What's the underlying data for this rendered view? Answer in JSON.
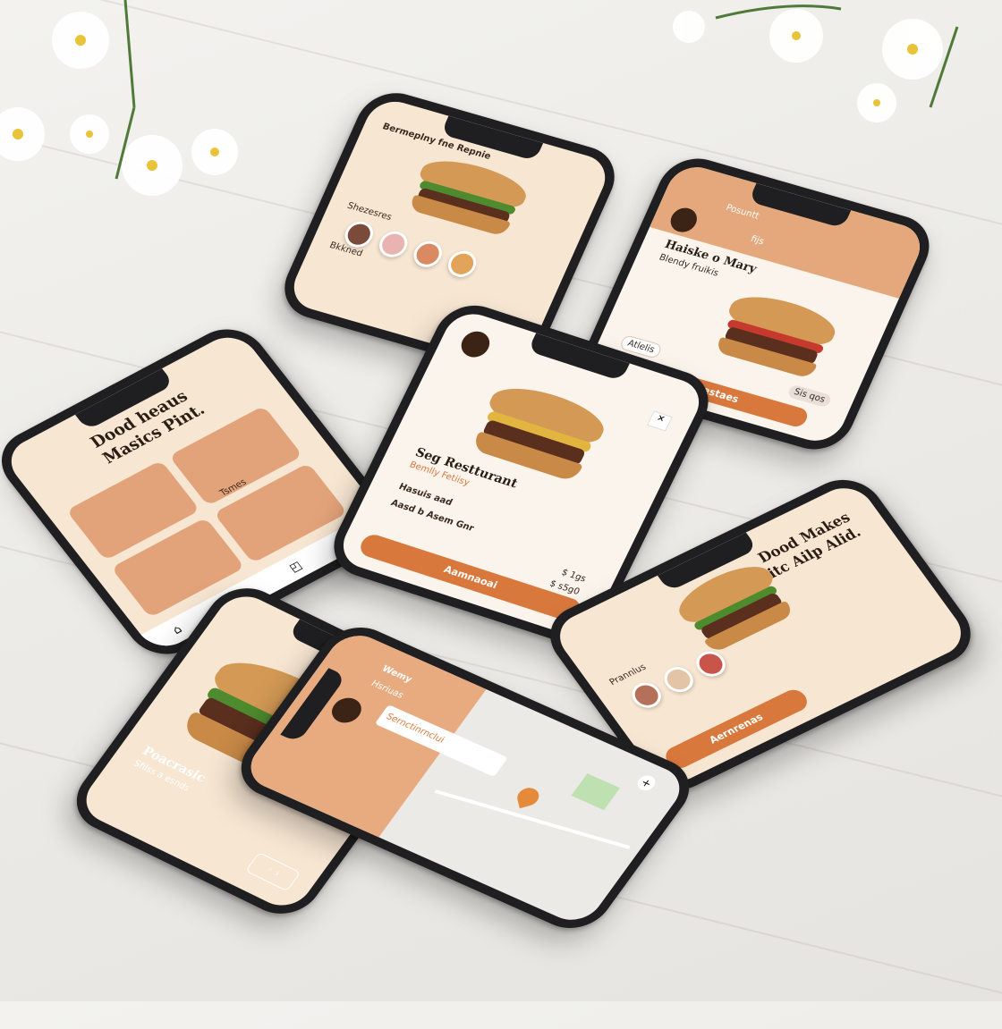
{
  "colors": {
    "accent": "#d9783d",
    "cream": "#f7e6d2",
    "peach": "#e9b48a",
    "dark": "#1f1f21"
  },
  "phones": {
    "top_center": {
      "header": "Bermeplny fne Repnie",
      "section1": "Shezesres",
      "section2": "Bkkned"
    },
    "top_right": {
      "header": "Posuntt",
      "tag": "fijs",
      "title": "Haiske o Mary",
      "sub": "Blendy fruikis",
      "btn1": "Atlelis",
      "btn2": "Sis qos",
      "bottom": "Isestaes"
    },
    "middle_left": {
      "title_line1": "Dood heaus",
      "title_line2": "Masics Pint.",
      "card_label": "Tsmes"
    },
    "center": {
      "title": "Seg Restturant",
      "subtitle": "Bemlly Fetiisy",
      "row1": "Hasuis aad",
      "row2": "Aasd b Asem Gnr",
      "price1": "$ 1gs",
      "price2": "$ s5g0",
      "button": "Aamnaoai"
    },
    "right": {
      "title_line1": "Dood Makes",
      "title_line2": "Witc Ailp Alid.",
      "section": "Prannlus",
      "button": "Aernrenas"
    },
    "bottom_left": {
      "title": "Poacrasic",
      "subtitle": "Sfilss a esnds"
    },
    "map": {
      "title": "Wemy",
      "subtitle": "Hsriuas",
      "search": "Sernctinrnclui"
    }
  }
}
